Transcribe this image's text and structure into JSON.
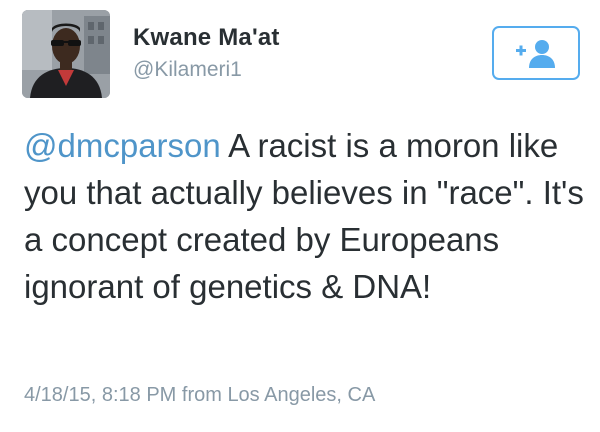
{
  "user": {
    "display_name": "Kwane Ma'at",
    "handle": "@Kilameri1",
    "avatar_icon": "profile-photo"
  },
  "follow_button": {
    "icon": "add-user-icon",
    "plus": "+",
    "color": "#55acee"
  },
  "tweet": {
    "mention": "@dmcparson",
    "text": " A racist is a moron like you that actually believes in \"race\". It's a concept created by Europeans ignorant of genetics & DNA!",
    "mention_color": "#4f95c9"
  },
  "meta": {
    "timestamp_location": "4/18/15, 8:18 PM from Los Angeles, CA"
  }
}
